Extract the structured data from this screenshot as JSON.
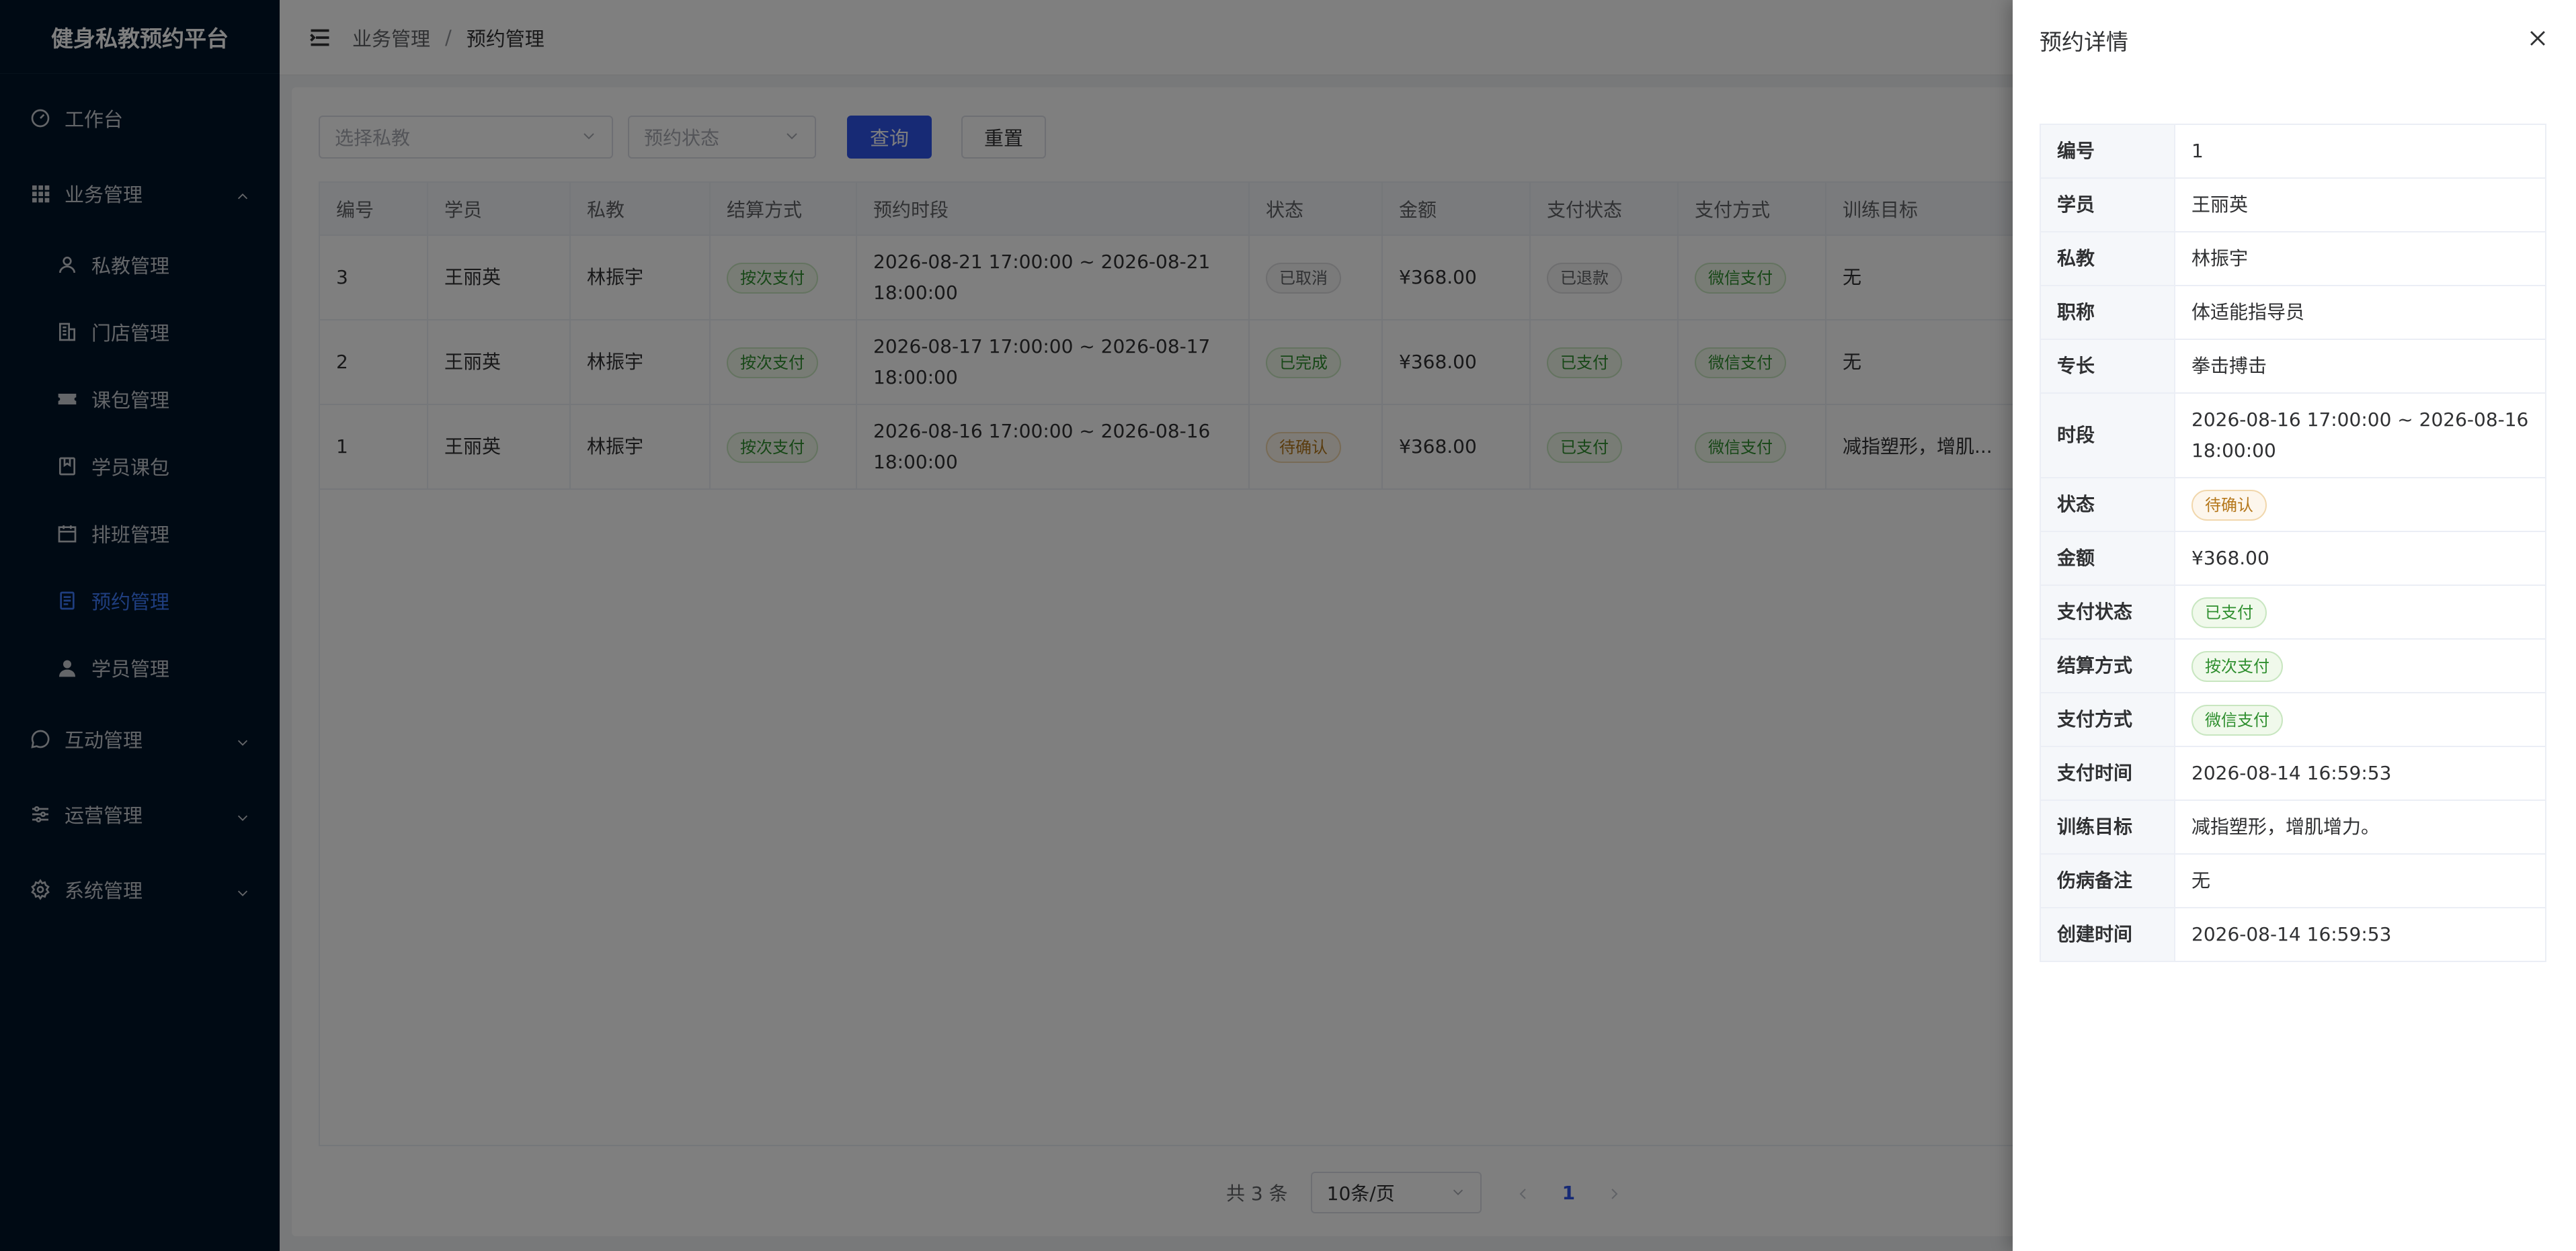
{
  "app": {
    "title": "健身私教预约平台"
  },
  "sidebar": {
    "items": [
      {
        "label": "工作台",
        "icon": "dashboard-icon"
      },
      {
        "label": "业务管理",
        "icon": "grid-icon",
        "expanded": true
      },
      {
        "label": "私教管理",
        "icon": "user-icon"
      },
      {
        "label": "门店管理",
        "icon": "building-icon"
      },
      {
        "label": "课包管理",
        "icon": "ticket-icon"
      },
      {
        "label": "学员课包",
        "icon": "package-icon"
      },
      {
        "label": "排班管理",
        "icon": "calendar-icon"
      },
      {
        "label": "预约管理",
        "icon": "document-icon",
        "active": true
      },
      {
        "label": "学员管理",
        "icon": "person-icon"
      },
      {
        "label": "互动管理",
        "icon": "chat-icon"
      },
      {
        "label": "运营管理",
        "icon": "sliders-icon"
      },
      {
        "label": "系统管理",
        "icon": "gear-icon"
      }
    ]
  },
  "header": {
    "breadcrumb": [
      "业务管理",
      "预约管理"
    ],
    "separator": "/"
  },
  "filters": {
    "coach_placeholder": "选择私教",
    "status_placeholder": "预约状态",
    "query_label": "查询",
    "reset_label": "重置"
  },
  "table": {
    "columns": [
      "编号",
      "学员",
      "私教",
      "结算方式",
      "预约时段",
      "状态",
      "金额",
      "支付状态",
      "支付方式",
      "训练目标"
    ],
    "rows": [
      [
        "3",
        "王丽英",
        "林振宇",
        "按次支付",
        "2026-08-21 17:00:00 ~ 2026-08-21 18:00:00",
        "已取消",
        "¥368.00",
        "已退款",
        "微信支付",
        "无"
      ],
      [
        "2",
        "王丽英",
        "林振宇",
        "按次支付",
        "2026-08-17 17:00:00 ~ 2026-08-17 18:00:00",
        "已完成",
        "¥368.00",
        "已支付",
        "微信支付",
        "无"
      ],
      [
        "1",
        "王丽英",
        "林振宇",
        "按次支付",
        "2026-08-16 17:00:00 ~ 2026-08-16 18:00:00",
        "待确认",
        "¥368.00",
        "已支付",
        "微信支付",
        "减指塑形，增肌..."
      ]
    ]
  },
  "pagination": {
    "total": "共 3 条",
    "page_size": "10条/页",
    "current": "1"
  },
  "drawer": {
    "title": "预约详情",
    "fields": [
      {
        "label": "编号",
        "value": "1"
      },
      {
        "label": "学员",
        "value": "王丽英"
      },
      {
        "label": "私教",
        "value": "林振宇"
      },
      {
        "label": "职称",
        "value": "体适能指导员"
      },
      {
        "label": "专长",
        "value": "拳击搏击"
      },
      {
        "label": "时段",
        "value": "2026-08-16 17:00:00 ~ 2026-08-16 18:00:00"
      },
      {
        "label": "状态",
        "value": "待确认"
      },
      {
        "label": "金额",
        "value": "¥368.00"
      },
      {
        "label": "支付状态",
        "value": "已支付"
      },
      {
        "label": "结算方式",
        "value": "按次支付"
      },
      {
        "label": "支付方式",
        "value": "微信支付"
      },
      {
        "label": "支付时间",
        "value": "2026-08-14 16:59:53"
      },
      {
        "label": "训练目标",
        "value": "减指塑形，增肌增力。"
      },
      {
        "label": "伤病备注",
        "value": "无"
      },
      {
        "label": "创建时间",
        "value": "2026-08-14 16:59:53"
      }
    ]
  },
  "colors": {
    "sidebar_bg": "#001529",
    "primary": "#2f54eb",
    "active_menu": "#3f7dff",
    "overlay": "rgba(0,0,0,0.5)"
  }
}
